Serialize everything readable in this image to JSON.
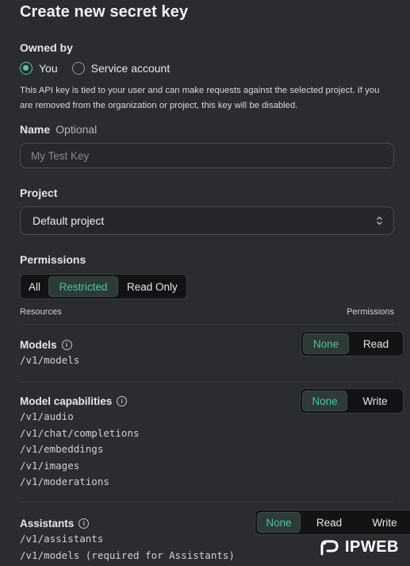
{
  "dialog": {
    "title": "Create new secret key"
  },
  "owned_by": {
    "label": "Owned by",
    "options": [
      "You",
      "Service account"
    ],
    "selected": "You",
    "help": "This API key is tied to your user and can make requests against the selected project. If you are removed from the organization or project, this key will be disabled."
  },
  "name": {
    "label": "Name",
    "optional": "Optional",
    "placeholder": "My Test Key"
  },
  "project": {
    "label": "Project",
    "value": "Default project"
  },
  "permissions": {
    "label": "Permissions",
    "options": [
      "All",
      "Restricted",
      "Read Only"
    ],
    "selected": "Restricted"
  },
  "table": {
    "col_resources": "Resources",
    "col_permissions": "Permissions",
    "rows": [
      {
        "title": "Models",
        "endpoints": [
          "/v1/models"
        ],
        "options": [
          "None",
          "Read"
        ],
        "selected": "None"
      },
      {
        "title": "Model capabilities",
        "endpoints": [
          "/v1/audio",
          "/v1/chat/completions",
          "/v1/embeddings",
          "/v1/images",
          "/v1/moderations"
        ],
        "options": [
          "None",
          "Write"
        ],
        "selected": "None"
      },
      {
        "title": "Assistants",
        "endpoints": [
          "/v1/assistants",
          "/v1/models (required for Assistants)"
        ],
        "options": [
          "None",
          "Read",
          "Write"
        ],
        "selected": "None"
      }
    ]
  },
  "watermark": {
    "text": "IPWEB"
  },
  "colors": {
    "accent": "#4fc3a1",
    "background": "#2b2c2f"
  }
}
